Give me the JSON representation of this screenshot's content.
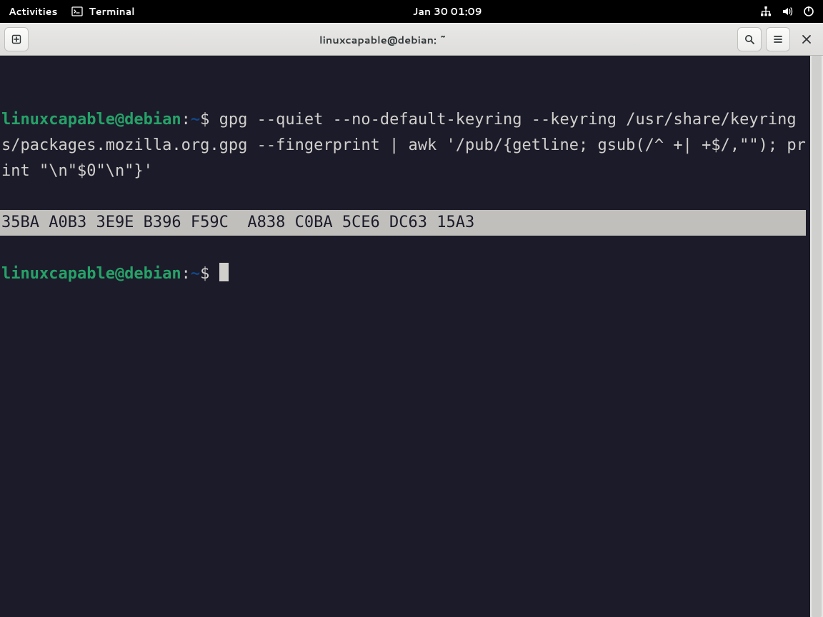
{
  "panel": {
    "activities": "Activities",
    "app_name": "Terminal",
    "clock": "Jan 30  01:09"
  },
  "titlebar": {
    "title": "linuxcapable@debian: ~"
  },
  "term": {
    "prompt_user": "linuxcapable@debian",
    "prompt_colon": ":",
    "prompt_path": "~",
    "prompt_symbol": "$",
    "command": "gpg --quiet --no-default-keyring --keyring /usr/share/keyrings/packages.mozilla.org.gpg --fingerprint | awk '/pub/{getline; gsub(/^ +| +$/,\"\"); print \"\\n\"$0\"\\n\"}'",
    "fingerprint": "35BA A0B3 3E9E B396 F59C  A838 C0BA 5CE6 DC63 15A3"
  }
}
